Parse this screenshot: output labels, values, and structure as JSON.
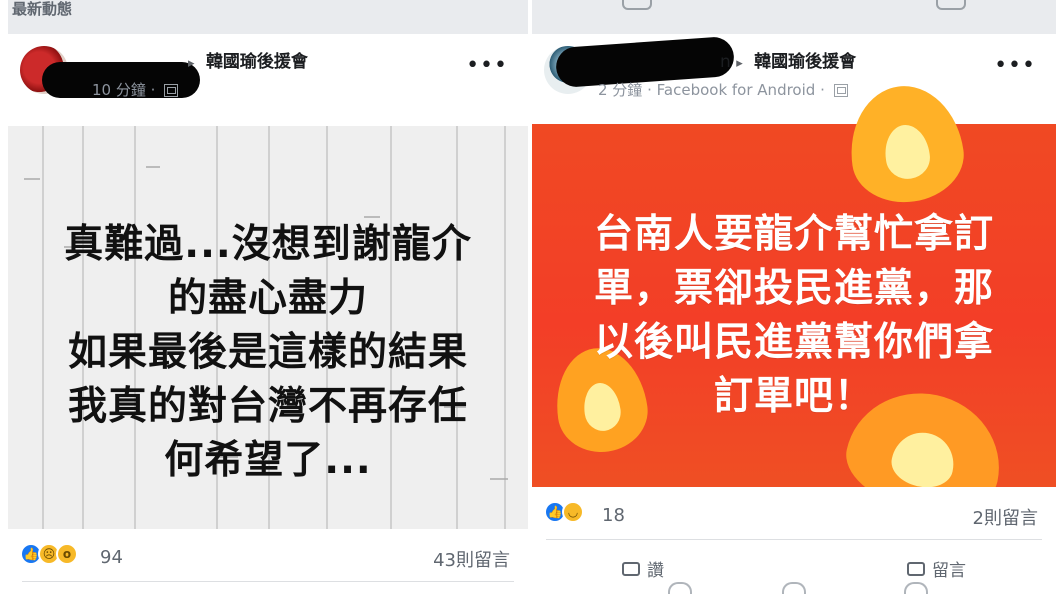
{
  "left_post": {
    "feed_header": "最新動態",
    "group_arrow": "▸",
    "group_name": "韓國瑜後援會",
    "time": "10 分鐘",
    "text_lines": [
      "真難過...沒想到謝龍介",
      "的盡心盡力",
      "如果最後是這樣的結果",
      "我真的對台灣不再存任",
      "何希望了..."
    ],
    "reaction_count": "94",
    "comment_count": "43則留言",
    "colors": {
      "background": "#efefef",
      "text": "#111111"
    }
  },
  "right_post": {
    "poster_visible": "n",
    "group_arrow": "▸",
    "group_name": "韓國瑜後援會",
    "time": "2 分鐘",
    "source": "Facebook for Android",
    "text_lines": [
      "台南人要龍介幫忙拿訂",
      "單，票卻投民進黨，那",
      "以後叫民進黨幫你們拿",
      "訂單吧！"
    ],
    "reaction_count": "18",
    "comment_count": "2則留言",
    "actions": {
      "like": "讚",
      "comment": "留言"
    },
    "colors": {
      "background": "#f24626",
      "text": "#ffffff",
      "flame_orange": "#ff8b1e",
      "flame_yellow": "#ffd24a"
    }
  },
  "shared": {
    "more_label": "•••",
    "reaction_icons": [
      "like-icon",
      "sad-icon",
      "wow-icon",
      "haha-icon"
    ],
    "accent_blue": "#1877f2",
    "reaction_yellow": "#f7b928",
    "muted_gray": "#606770"
  }
}
